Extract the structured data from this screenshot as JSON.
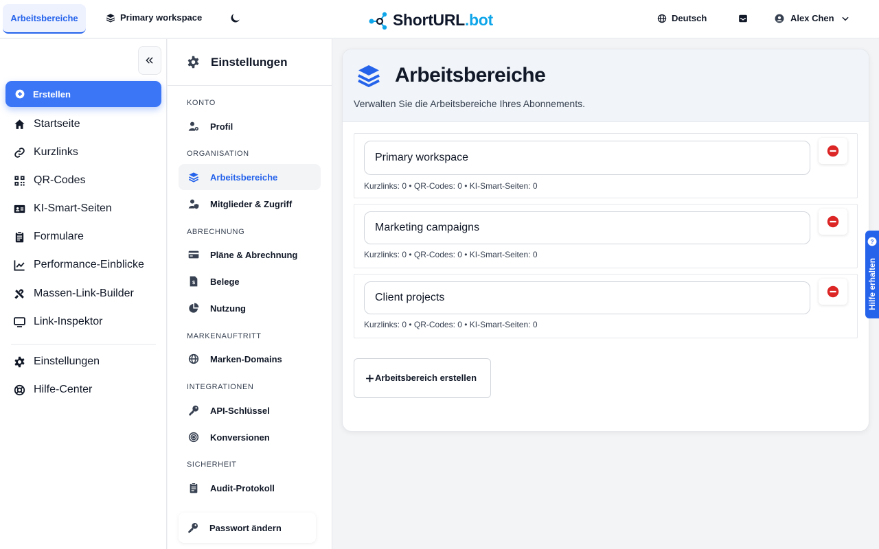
{
  "topbar": {
    "active_tab": "Arbeitsbereiche",
    "workspace_switcher": "Primary workspace",
    "logo_main": "ShortURL",
    "logo_accent": ".bot",
    "language": "Deutsch",
    "user_name": "Alex Chen"
  },
  "sidebar": {
    "create_label": "Erstellen",
    "items": [
      {
        "label": "Startseite",
        "icon": "home-icon"
      },
      {
        "label": "Kurzlinks",
        "icon": "link-icon"
      },
      {
        "label": "QR-Codes",
        "icon": "qr-code-icon"
      },
      {
        "label": "KI-Smart-Seiten",
        "icon": "id-card-icon"
      },
      {
        "label": "Formulare",
        "icon": "clipboard-icon"
      },
      {
        "label": "Performance-Einblicke",
        "icon": "chart-line-icon"
      },
      {
        "label": "Massen-Link-Builder",
        "icon": "tools-icon"
      },
      {
        "label": "Link-Inspektor",
        "icon": "monitor-icon"
      }
    ],
    "bottom_items": [
      {
        "label": "Einstellungen",
        "icon": "gear-icon"
      },
      {
        "label": "Hilfe-Center",
        "icon": "lifebuoy-icon"
      }
    ]
  },
  "settings": {
    "title": "Einstellungen",
    "sections": {
      "konto": "KONTO",
      "organisation": "ORGANISATION",
      "abrechnung": "ABRECHNUNG",
      "markenauftritt": "MARKENAUFTRITT",
      "integrationen": "INTEGRATIONEN",
      "sicherheit": "SICHERHEIT"
    },
    "items": {
      "profil": "Profil",
      "arbeitsbereiche": "Arbeitsbereiche",
      "mitglieder": "Mitglieder & Zugriff",
      "plaene": "Pläne & Abrechnung",
      "belege": "Belege",
      "nutzung": "Nutzung",
      "domains": "Marken-Domains",
      "api": "API-Schlüssel",
      "konversionen": "Konversionen",
      "audit": "Audit-Protokoll"
    },
    "password": "Passwort ändern"
  },
  "main": {
    "title": "Arbeitsbereiche",
    "subtitle": "Verwalten Sie die Arbeitsbereiche Ihres Abonnements.",
    "workspaces": [
      {
        "name": "Primary workspace",
        "stats": "Kurzlinks: 0 • QR-Codes: 0 • KI-Smart-Seiten: 0"
      },
      {
        "name": "Marketing campaigns",
        "stats": "Kurzlinks: 0 • QR-Codes: 0 • KI-Smart-Seiten: 0"
      },
      {
        "name": "Client projects",
        "stats": "Kurzlinks: 0 • QR-Codes: 0 • KI-Smart-Seiten: 0"
      }
    ],
    "add_label": "Arbeitsbereich erstellen"
  },
  "help_tab": "Hilfe erhalten",
  "colors": {
    "accent": "#2563eb",
    "create_button": "#3b76f6",
    "delete": "#dc2626",
    "logo_accent": "#0ea5e9"
  }
}
